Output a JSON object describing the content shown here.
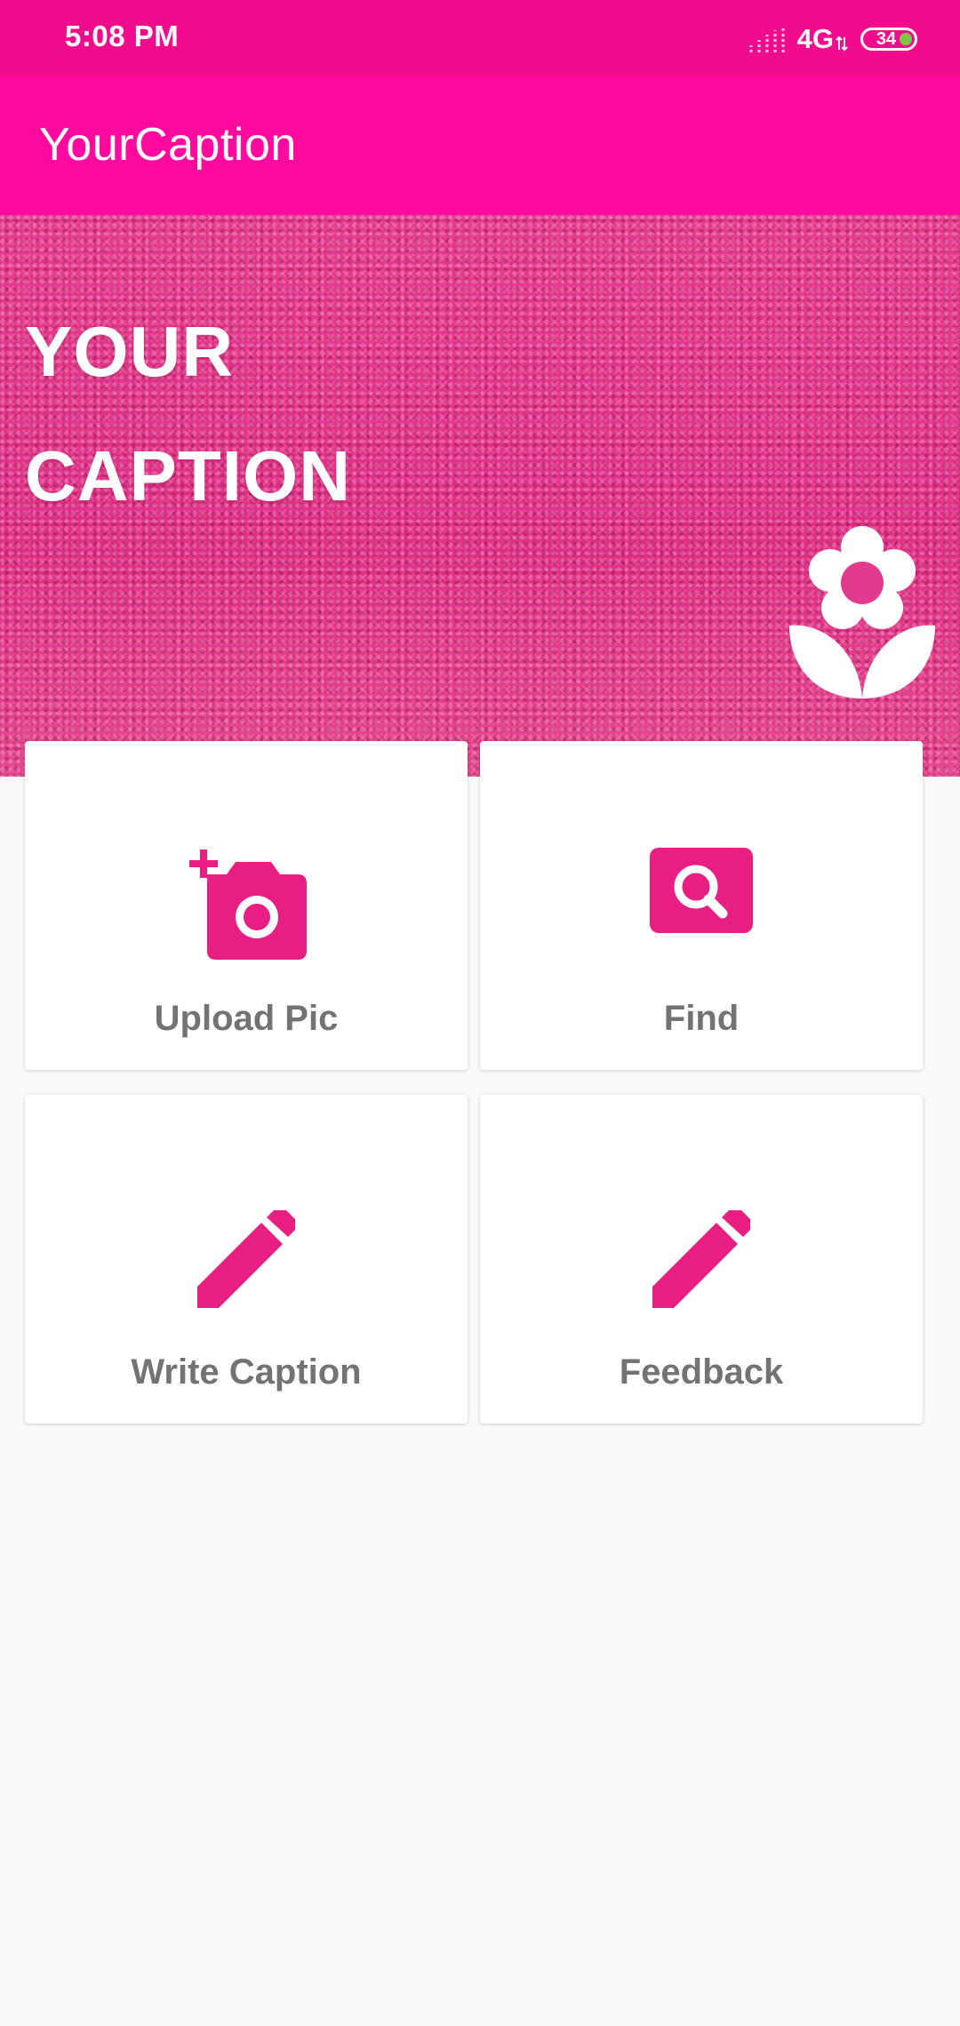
{
  "status_bar": {
    "time": "5:08 PM",
    "network": "4G",
    "battery_level": "34",
    "icons": [
      "signal-icon",
      "data-arrows-icon",
      "battery-icon"
    ],
    "battery_fill_color": "#7ac943"
  },
  "app_bar": {
    "title": "YourCaption",
    "background": "#ff0a9e"
  },
  "hero": {
    "line1": "YOUR",
    "line2": "CAPTION",
    "icon": "flower-icon"
  },
  "cards": [
    {
      "label": "Upload Pic",
      "icon": "add-photo-icon"
    },
    {
      "label": "Find",
      "icon": "search-icon"
    },
    {
      "label": "Write Caption",
      "icon": "pencil-icon"
    },
    {
      "label": "Feedback",
      "icon": "pencil-icon"
    }
  ],
  "colors": {
    "accent": "#e91e83",
    "status_bar": "#f00c8c",
    "label_gray": "#737373",
    "background": "#fafafa"
  }
}
